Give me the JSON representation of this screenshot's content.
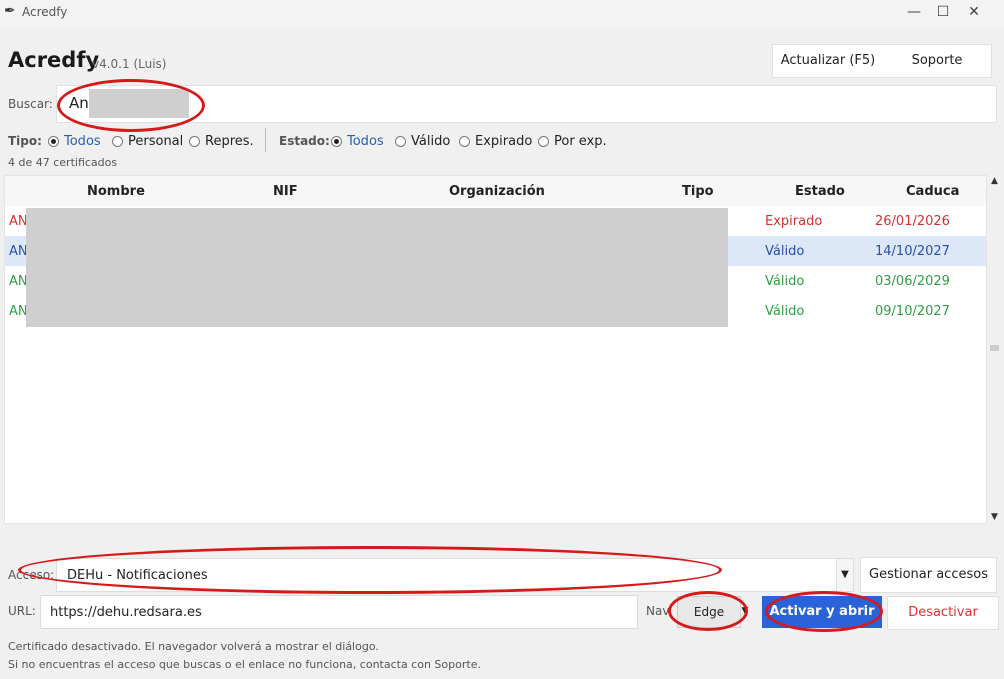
{
  "window": {
    "title": "Acredfy",
    "minimize_icon": "minimize-icon",
    "maximize_icon": "maximize-icon",
    "close_icon": "close-icon"
  },
  "header": {
    "app_name": "Acredfy",
    "version": "v4.0.1  (Luis)"
  },
  "toolbar": {
    "update_label": "Actualizar (F5)",
    "support_label": "Soporte"
  },
  "search": {
    "label": "Buscar:",
    "value": "An"
  },
  "filters": {
    "tipo_label": "Tipo:",
    "tipo_options": [
      "Todos",
      "Personal",
      "Repres."
    ],
    "tipo_selected": "Todos",
    "estado_label": "Estado:",
    "estado_options": [
      "Todos",
      "Válido",
      "Expirado",
      "Por exp."
    ],
    "estado_selected": "Todos"
  },
  "count_text": "4 de 47 certificados",
  "table": {
    "headers": [
      "Nombre",
      "NIF",
      "Organización",
      "Tipo",
      "Estado",
      "Caduca"
    ],
    "rows": [
      {
        "nombre": "AN",
        "estado": "Expirado",
        "caduca": "26/01/2026",
        "color": "#d32f2f",
        "selected": false
      },
      {
        "nombre": "AN",
        "estado": "Válido",
        "caduca": "14/10/2027",
        "color": "#2a4fa8",
        "selected": true
      },
      {
        "nombre": "AN",
        "estado": "Válido",
        "caduca": "03/06/2029",
        "color": "#2e9e44",
        "selected": false
      },
      {
        "nombre": "AN",
        "estado": "Válido",
        "caduca": "09/10/2027",
        "color": "#2e9e44",
        "selected": false
      }
    ]
  },
  "access": {
    "label": "Acceso:",
    "value": "DEHu - Notificaciones",
    "manage_label": "Gestionar accesos"
  },
  "url": {
    "label": "URL:",
    "value": "https://dehu.redsara.es"
  },
  "browser": {
    "label": "Nav",
    "value": "Edge"
  },
  "actions": {
    "activate_label": "Activar y abrir",
    "deactivate_label": "Desactivar"
  },
  "status": {
    "line1": "Certificado desactivado. El navegador volverá a mostrar el diálogo.",
    "line2": "Si no encuentras el acceso que buscas o el enlace no funciona, contacta con Soporte."
  },
  "colors": {
    "accent": "#2962d9",
    "expired": "#d32f2f",
    "valid": "#2e9e44",
    "danger": "#dd3333"
  }
}
